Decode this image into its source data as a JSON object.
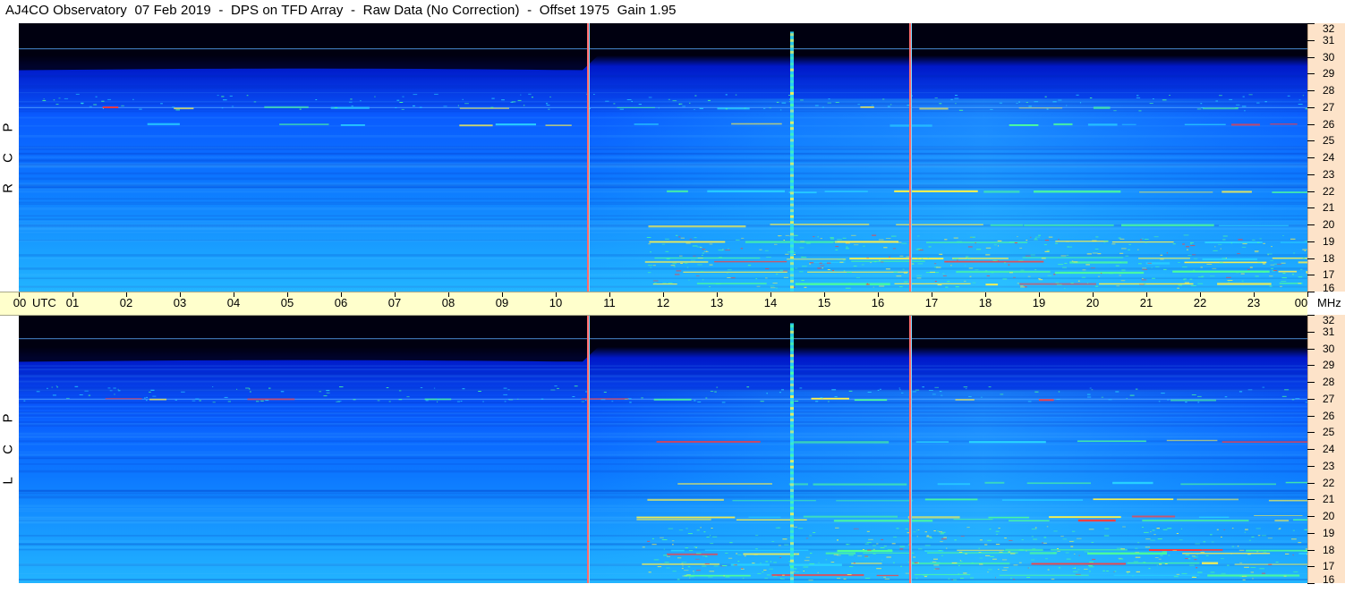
{
  "title": "AJ4CO Observatory  07 Feb 2019  -  DPS on TFD Array  -  Raw Data (No Correction)  -  Offset 1975  Gain 1.95",
  "chart_data": {
    "type": "heatmap",
    "x_axis": {
      "unit": "UTC",
      "range": [
        0,
        24
      ],
      "tick_labels": [
        "00",
        "01",
        "02",
        "03",
        "04",
        "05",
        "06",
        "07",
        "08",
        "09",
        "10",
        "11",
        "12",
        "13",
        "14",
        "15",
        "16",
        "17",
        "18",
        "19",
        "20",
        "21",
        "22",
        "23",
        "00"
      ]
    },
    "y_axis": {
      "unit": "MHz",
      "range": [
        16,
        32
      ],
      "tick_labels": [
        "32",
        "31",
        "30",
        "29",
        "28",
        "27",
        "26",
        "25",
        "24",
        "23",
        "22",
        "21",
        "20",
        "19",
        "18",
        "17",
        "16"
      ]
    },
    "panels": [
      {
        "label": "R C P",
        "letters": [
          "R",
          "C",
          "P"
        ],
        "sunrise_utc": 10.6,
        "sunset_utc": 16.6,
        "bright_vertical_utc": 14.4,
        "horizontal_lines_mhz": [
          27.0,
          30.5
        ],
        "interference_bands_mhz": [
          16.5,
          17.2,
          17.8,
          18.0,
          19.0,
          20.0,
          22.0,
          26.0,
          27.0
        ]
      },
      {
        "label": "L C P",
        "letters": [
          "L",
          "C",
          "P"
        ],
        "sunrise_utc": 10.6,
        "sunset_utc": 16.6,
        "bright_vertical_utc": 14.4,
        "horizontal_lines_mhz": [
          27.0,
          30.6
        ],
        "interference_bands_mhz": [
          16.5,
          17.2,
          17.8,
          18.0,
          19.8,
          20.0,
          21.0,
          22.0,
          24.5,
          27.0
        ]
      }
    ]
  },
  "colors": {
    "background_low": "#000010",
    "deep_blue": "#0018c8",
    "blue": "#0a5cff",
    "light_blue": "#1aa0ff",
    "cyan": "#2ad8ff",
    "green": "#4cff9a",
    "yellow": "#fff24a",
    "red": "#ff3b3b",
    "time_bar": "#ffffcc",
    "freq_bar": "#fde3c9"
  }
}
